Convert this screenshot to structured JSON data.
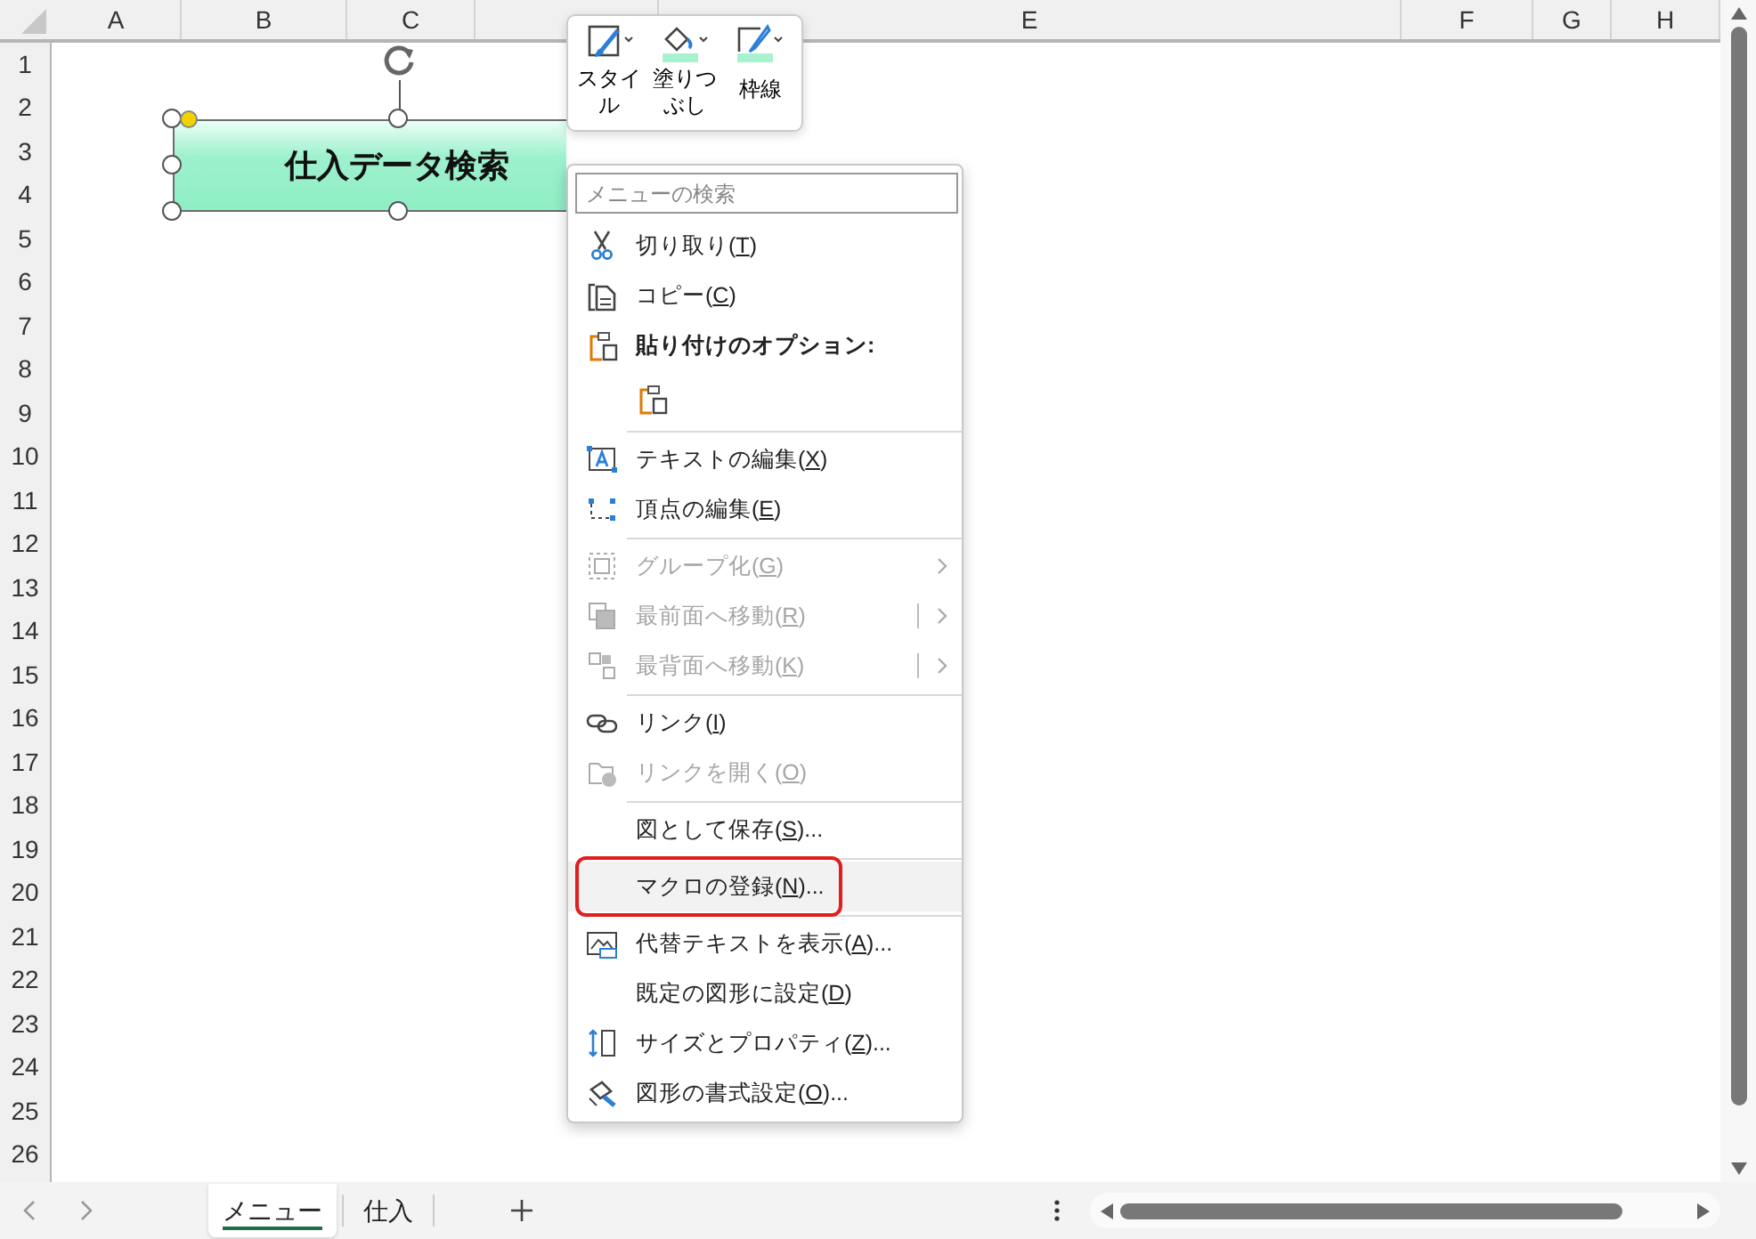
{
  "columns": [
    {
      "label": "A"
    },
    {
      "label": "B"
    },
    {
      "label": "C"
    },
    {},
    {
      "label": "E"
    },
    {
      "label": "F"
    },
    {
      "label": "G"
    },
    {
      "label": "H"
    }
  ],
  "rows": [
    "1",
    "2",
    "3",
    "4",
    "5",
    "6",
    "7",
    "8",
    "9",
    "10",
    "11",
    "12",
    "13",
    "14",
    "15",
    "16",
    "17",
    "18",
    "19",
    "20",
    "21",
    "22",
    "23",
    "24",
    "25",
    "26"
  ],
  "shape": {
    "text": "仕入データ検索",
    "selected": true
  },
  "mini_toolbar": [
    {
      "label": "スタイル"
    },
    {
      "label": "塗りつぶし"
    },
    {
      "label": "枠線"
    }
  ],
  "context_menu": {
    "search": {
      "placeholder": "メニューの検索"
    },
    "items": [
      {
        "kind": "item",
        "before": "切り取り(",
        "key": "T",
        "after": ")",
        "disabled": false
      },
      {
        "kind": "item",
        "before": "コピー(",
        "key": "C",
        "after": ")",
        "disabled": false
      },
      {
        "kind": "header",
        "before": "貼り付けのオプション:"
      },
      {
        "kind": "paste"
      },
      {
        "kind": "separator"
      },
      {
        "kind": "item",
        "before": "テキストの編集(",
        "key": "X",
        "after": ")",
        "disabled": false
      },
      {
        "kind": "item",
        "before": "頂点の編集(",
        "key": "E",
        "after": ")",
        "disabled": false
      },
      {
        "kind": "separator"
      },
      {
        "kind": "submenu",
        "before": "グループ化(",
        "key": "G",
        "after": ")",
        "disabled": true
      },
      {
        "kind": "split",
        "before": "最前面へ移動(",
        "key": "R",
        "after": ")",
        "disabled": true
      },
      {
        "kind": "split",
        "before": "最背面へ移動(",
        "key": "K",
        "after": ")",
        "disabled": true
      },
      {
        "kind": "separator"
      },
      {
        "kind": "item",
        "before": "リンク(",
        "key": "I",
        "after": ")",
        "disabled": false
      },
      {
        "kind": "item",
        "before": "リンクを開く(",
        "key": "O",
        "after": ")",
        "disabled": true
      },
      {
        "kind": "separator"
      },
      {
        "kind": "item",
        "before": "図として保存(",
        "key": "S",
        "after": ")...",
        "disabled": false
      },
      {
        "kind": "separator"
      },
      {
        "kind": "item",
        "before": "マクロの登録(",
        "key": "N",
        "after": ")...",
        "disabled": false,
        "hovered": true,
        "annotated": true
      },
      {
        "kind": "separator"
      },
      {
        "kind": "item",
        "before": "代替テキストを表示(",
        "key": "A",
        "after": ")...",
        "disabled": false
      },
      {
        "kind": "item",
        "before": "既定の図形に設定(",
        "key": "D",
        "after": ")",
        "disabled": false
      },
      {
        "kind": "item",
        "before": "サイズとプロパティ(",
        "key": "Z",
        "after": ")...",
        "disabled": false
      },
      {
        "kind": "item",
        "before": "図形の書式設定(",
        "key": "O",
        "after": ")...",
        "disabled": false
      }
    ]
  },
  "sheet_tabs": [
    {
      "label": "メニュー",
      "selected": true
    },
    {
      "label": "仕入",
      "selected": false
    }
  ]
}
